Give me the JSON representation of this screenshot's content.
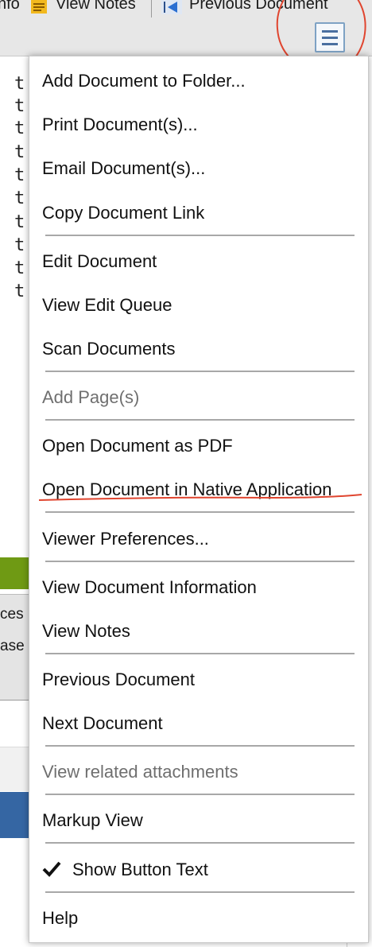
{
  "toolbar": {
    "info_label": "nfo",
    "view_notes_label": "View Notes",
    "previous_document_label": "Previous Document",
    "menu_icon": "hamburger-menu-icon"
  },
  "document": {
    "visible_chars": [
      "t",
      "t",
      "t",
      "t",
      "t",
      "t",
      "t",
      "t",
      "t",
      "t"
    ]
  },
  "background": {
    "text1": "ces",
    "text2": "ase"
  },
  "menu": {
    "items": [
      {
        "label": "Add Document to Folder..."
      },
      {
        "label": "Print Document(s)..."
      },
      {
        "label": "Email Document(s)..."
      },
      {
        "label": "Copy Document Link"
      },
      {
        "label": "Edit Document"
      },
      {
        "label": "View Edit Queue"
      },
      {
        "label": "Scan Documents"
      },
      {
        "label": "Add Page(s)",
        "disabled": true
      },
      {
        "label": "Open Document as PDF"
      },
      {
        "label": "Open Document in Native Application"
      },
      {
        "label": "Viewer Preferences..."
      },
      {
        "label": "View Document Information"
      },
      {
        "label": "View Notes"
      },
      {
        "label": "Previous Document"
      },
      {
        "label": "Next Document"
      },
      {
        "label": "View related attachments",
        "disabled": true
      },
      {
        "label": "Markup View"
      },
      {
        "label": "Show Button Text",
        "checked": true
      },
      {
        "label": "Help"
      }
    ]
  },
  "colors": {
    "annotation": "#e0452f",
    "accent_blue": "#3566a3",
    "accent_green": "#6f9a14"
  }
}
